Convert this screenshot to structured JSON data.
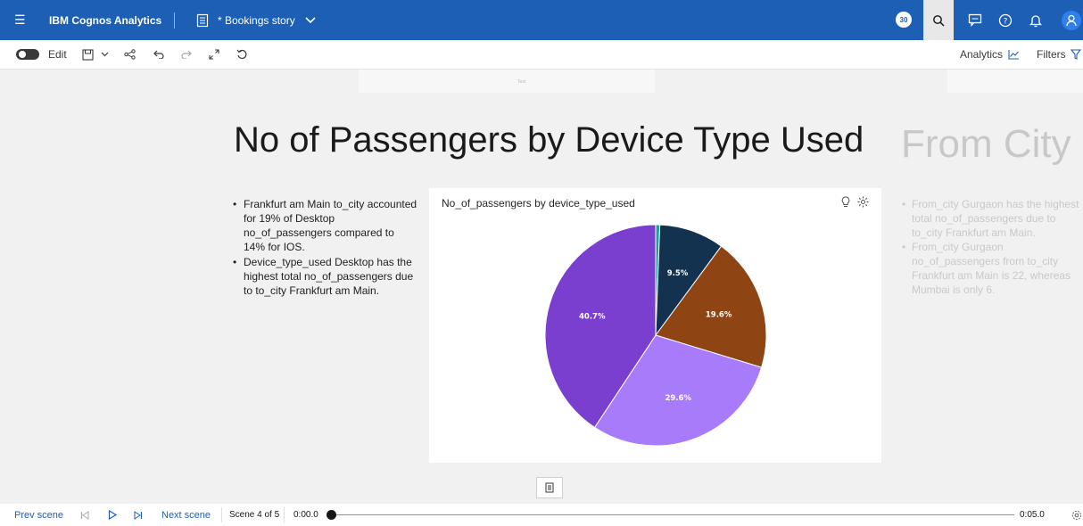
{
  "topbar": {
    "app_name": "IBM Cognos Analytics",
    "story_title": "* Bookings story",
    "badge_text": "30",
    "icons": [
      "hamburger-icon",
      "story-icon",
      "chevron-down-icon",
      "search-icon",
      "chat-icon",
      "help-icon",
      "notification-icon",
      "user-icon"
    ]
  },
  "toolbar": {
    "edit_label": "Edit",
    "analytics_label": "Analytics",
    "filters_label": "Filters"
  },
  "canvas": {
    "ghost_label": "Text",
    "title": "No of Passengers by Device Type Used",
    "next_title": "From City",
    "insights": [
      "Frankfurt am Main to_city accounted for 19% of Desktop no_of_passengers compared to 14% for IOS.",
      "Device_type_used Desktop has the highest total no_of_passengers due to to_city Frankfurt am Main."
    ],
    "next_insights": [
      "From_city Gurgaon has the highest total no_of_passengers due to to_city Frankfurt am Main.",
      "From_city Gurgaon no_of_passengers from to_city Frankfurt am Main is 22, whereas Mumbai is only 6."
    ]
  },
  "chart_data": {
    "type": "pie",
    "title": "No_of_passengers by device_type_used",
    "slices": [
      {
        "value": 0.6,
        "label": "",
        "color": "#1aa39a"
      },
      {
        "value": 9.5,
        "label": "9.5%",
        "color": "#13324f"
      },
      {
        "value": 19.6,
        "label": "19.6%",
        "color": "#8e4513"
      },
      {
        "value": 29.6,
        "label": "29.6%",
        "color": "#a77bfa"
      },
      {
        "value": 40.7,
        "label": "40.7%",
        "color": "#7b3fcf"
      }
    ]
  },
  "playback": {
    "prev_label": "Prev scene",
    "next_label": "Next scene",
    "scene_label": "Scene 4 of 5",
    "time_start": "0:00.0",
    "time_end": "0:05.0"
  },
  "colors": {
    "accent": "#1c5fb5",
    "background": "#f1f1f1"
  }
}
